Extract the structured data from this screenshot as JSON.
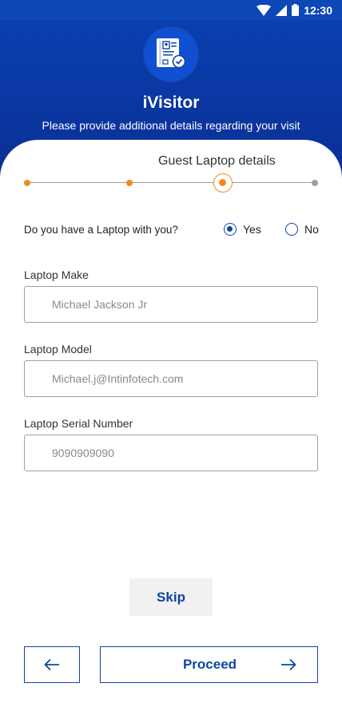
{
  "status_bar": {
    "time": "12:30",
    "icons": [
      "wifi-icon",
      "signal-icon",
      "battery-icon"
    ]
  },
  "header": {
    "logo_icon": "visitor-badge-icon",
    "title": "iVisitor",
    "subtitle": "Please provide additional details regarding your visit"
  },
  "stepper": {
    "title": "Guest Laptop details",
    "total_steps": 4,
    "current_step": 3,
    "colors": {
      "done": "#f08a1c",
      "pending": "#9e9e9e"
    }
  },
  "laptop_question": {
    "text": "Do you have a Laptop with you?",
    "options": [
      {
        "label": "Yes",
        "selected": true
      },
      {
        "label": "No",
        "selected": false
      }
    ]
  },
  "form": {
    "laptop_make": {
      "label": "Laptop Make",
      "placeholder": "Michael Jackson Jr"
    },
    "laptop_model": {
      "label": "Laptop Model",
      "placeholder": "Michael.j@Intinfotech.com"
    },
    "serial_number": {
      "label": "Laptop Serial Number",
      "placeholder": "9090909090"
    }
  },
  "actions": {
    "skip_label": "Skip",
    "proceed_label": "Proceed",
    "back_icon": "arrow-left-icon",
    "proceed_icon": "arrow-right-icon"
  },
  "colors": {
    "primary": "#0d47a1",
    "header_bg": "#0a3fb0",
    "accent": "#f08a1c"
  }
}
